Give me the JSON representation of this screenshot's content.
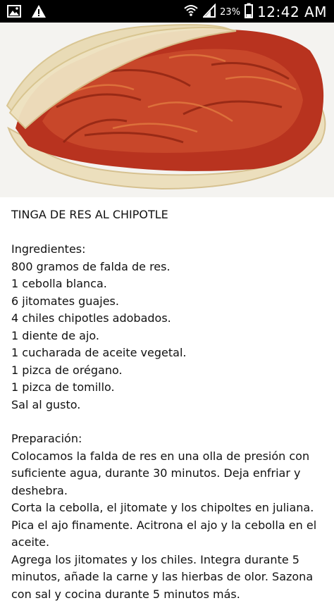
{
  "status_bar": {
    "icons": [
      "image-icon",
      "warning-icon",
      "wifi-icon",
      "signal-icon",
      "battery-icon"
    ],
    "battery_percent": "23%",
    "time": "12:42 AM"
  },
  "photo": {
    "subject": "Tinga de res en tortilla"
  },
  "recipe": {
    "title": "TINGA DE RES AL CHIPOTLE",
    "ingredients_heading": "Ingredientes:",
    "ingredients": [
      "800 gramos de falda de res.",
      "1 cebolla blanca.",
      "6 jitomates guajes.",
      "4 chiles chipotles adobados.",
      "1 diente de ajo.",
      "1 cucharada de aceite vegetal.",
      "1 pizca de orégano.",
      "1 pizca de tomillo.",
      "Sal al gusto."
    ],
    "preparation_heading": "Preparación:",
    "preparation": [
      "Colocamos la falda de res en una olla de presión con suficiente agua, durante 30 minutos. Deja enfriar y deshebra.",
      "Corta la cebolla, el jitomate y los chipoltes en juliana. Pica el ajo finamente. Acitrona el ajo y la cebolla en el aceite.",
      "Agrega los jitomates y los chiles. Integra durante 5 minutos, añade la carne y las hierbas de olor. Sazona con sal y cocina durante 5 minutos más."
    ]
  }
}
